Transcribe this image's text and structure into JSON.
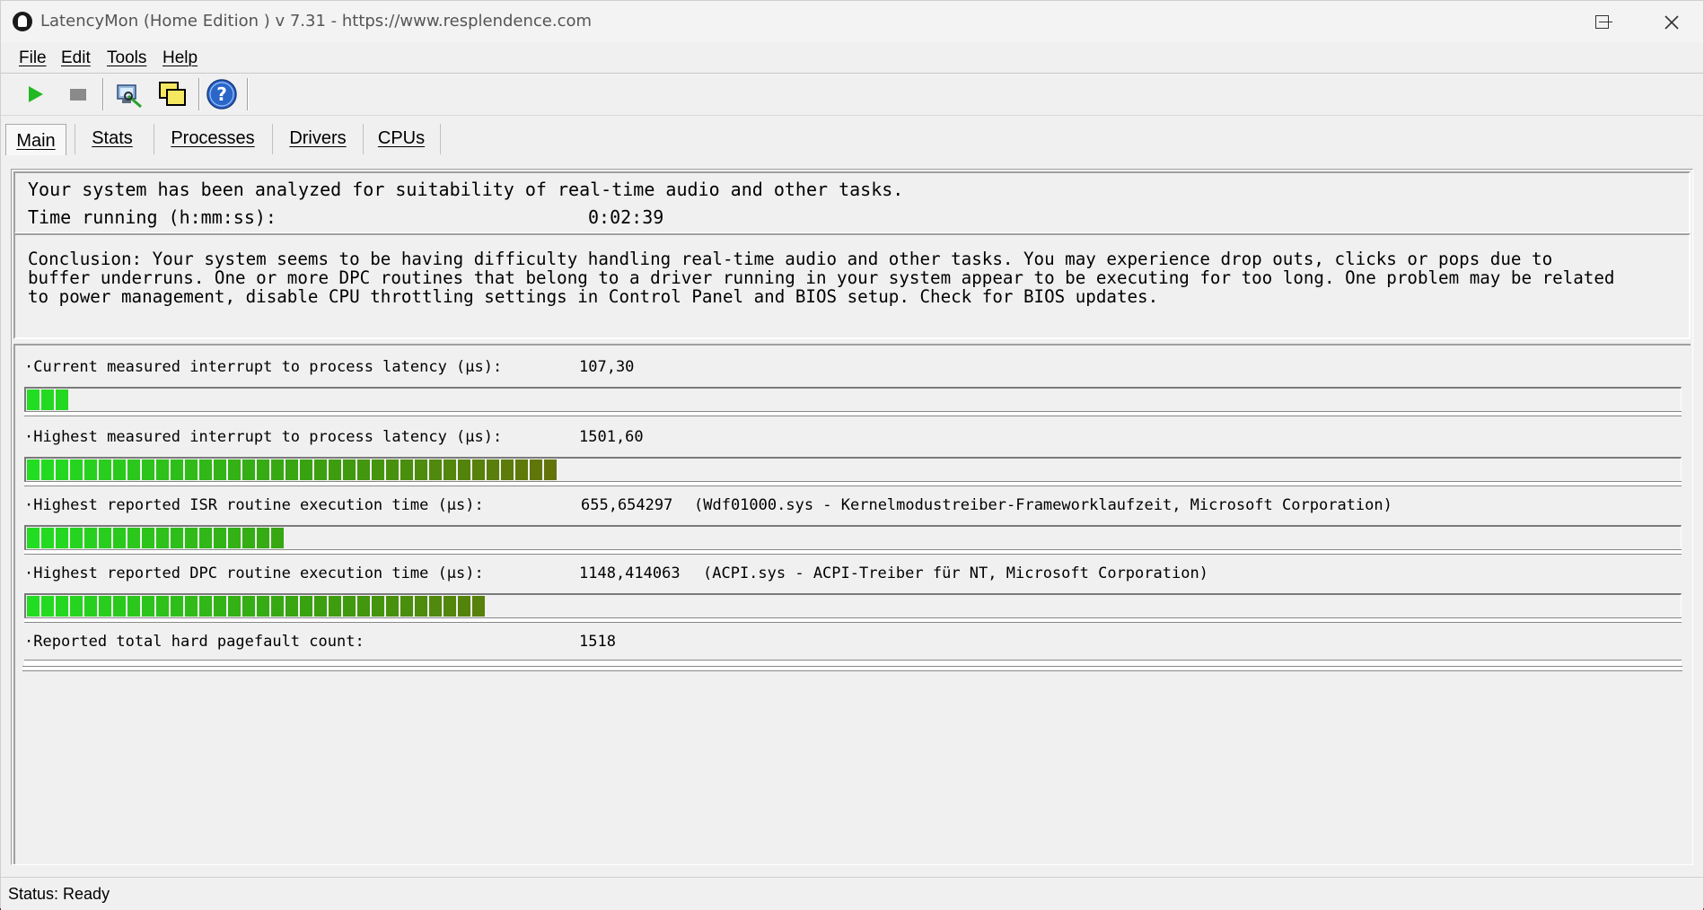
{
  "window": {
    "title": "LatencyMon  (Home Edition )  v 7.31 - https://www.resplendence.com"
  },
  "menu": [
    "File",
    "Edit",
    "Tools",
    "Help"
  ],
  "toolbar": {
    "buttons": [
      {
        "name": "start-monitor-icon"
      },
      {
        "name": "stop-monitor-icon"
      },
      {
        "name": "system-info-icon"
      },
      {
        "name": "windows-cascade-icon"
      },
      {
        "name": "help-icon"
      }
    ]
  },
  "tabs": [
    "Main",
    "Stats",
    "Processes",
    "Drivers",
    "CPUs"
  ],
  "summary": {
    "line1": "Your system has been analyzed for suitability of real-time audio and other tasks.",
    "time_label": "Time running (h:mm:ss):",
    "time_value": "0:02:39"
  },
  "conclusion": {
    "line1": "Conclusion: Your system seems to be having difficulty handling real-time audio and other tasks. You may experience drop outs, clicks or pops due to",
    "line2": "buffer underruns. One or more DPC routines that belong to a driver running in your system appear to be executing for too long. One problem may be related",
    "line3": "to power management, disable CPU throttling settings in Control Panel and BIOS setup. Check for BIOS updates."
  },
  "metrics": [
    {
      "label": "·Current measured interrupt to process latency (µs):",
      "value": "107,30",
      "detail": "",
      "segments": 3
    },
    {
      "label": "·Highest measured interrupt to process latency (µs):",
      "value": "1501,60",
      "detail": "",
      "segments": 37
    },
    {
      "label": "·Highest reported ISR routine execution time (µs):",
      "value": "655,654297",
      "detail": "(Wdf01000.sys - Kernelmodustreiber-Frameworklaufzeit, Microsoft Corporation)",
      "segments": 18
    },
    {
      "label": "·Highest reported DPC routine execution time (µs):",
      "value": "1148,414063",
      "detail": "(ACPI.sys - ACPI-Treiber für NT, Microsoft Corporation)",
      "segments": 32
    },
    {
      "label": "·Reported total hard pagefault count:",
      "value": "1518",
      "detail": "",
      "segments": 0
    }
  ],
  "colors": {
    "bar_start": "#22dd22",
    "bar_mid": "#3aa010",
    "bar_end": "#6b6b08"
  },
  "status": "Status: Ready"
}
